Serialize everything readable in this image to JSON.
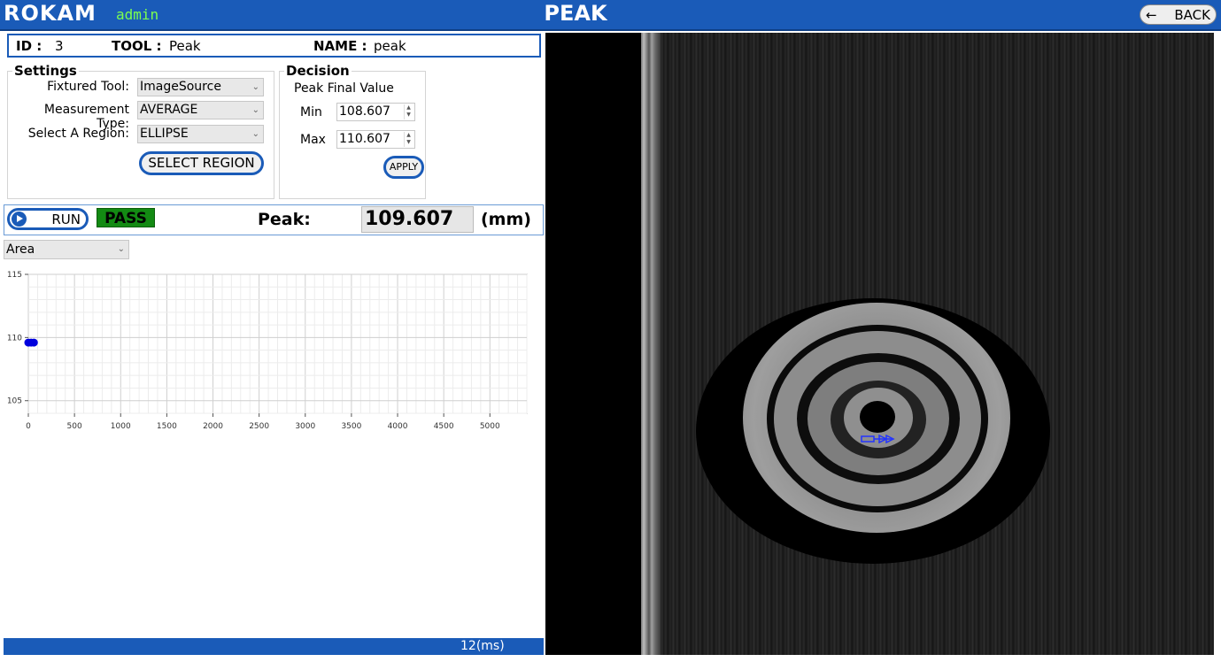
{
  "app": {
    "logo": "ROKAM",
    "user": "admin",
    "title": "PEAK",
    "back_label": "BACK"
  },
  "header": {
    "id_key": "ID :",
    "id_value": "3",
    "tool_key": "TOOL :",
    "tool_value": "Peak",
    "name_key": "NAME :",
    "name_value": "peak"
  },
  "settings": {
    "title": "Settings",
    "fixtured_tool_label": "Fixtured Tool:",
    "fixtured_tool_value": "ImageSource",
    "measurement_type_label": "Measurement Type:",
    "measurement_type_value": "AVERAGE",
    "region_label": "Select A Region:",
    "region_value": "ELLIPSE",
    "select_region_button": "SELECT REGION"
  },
  "decision": {
    "title": "Decision",
    "subtitle": "Peak Final Value",
    "min_label": "Min",
    "min_value": "108.607",
    "max_label": "Max",
    "max_value": "110.607",
    "apply_button": "APPLY"
  },
  "run": {
    "run_button": "RUN",
    "status": "PASS",
    "peak_label": "Peak:",
    "peak_value": "109.607",
    "unit": "(mm)"
  },
  "plot_selector": {
    "value": "Area"
  },
  "chart_data": {
    "type": "scatter",
    "x": [
      0,
      30,
      60
    ],
    "y": [
      109.6,
      109.6,
      109.6
    ],
    "xlim": [
      0,
      5400
    ],
    "ylim": [
      104,
      115
    ],
    "xticks": [
      0,
      500,
      1000,
      1500,
      2000,
      2500,
      3000,
      3500,
      4000,
      4500,
      5000
    ],
    "yticks": [
      105,
      110,
      115
    ],
    "grid": true,
    "marker_color": "#0000dd"
  },
  "status_bar": {
    "time": "12(ms)"
  },
  "colors": {
    "accent": "#1a5bb8",
    "pass": "#138a13",
    "user": "#7cff4f"
  }
}
